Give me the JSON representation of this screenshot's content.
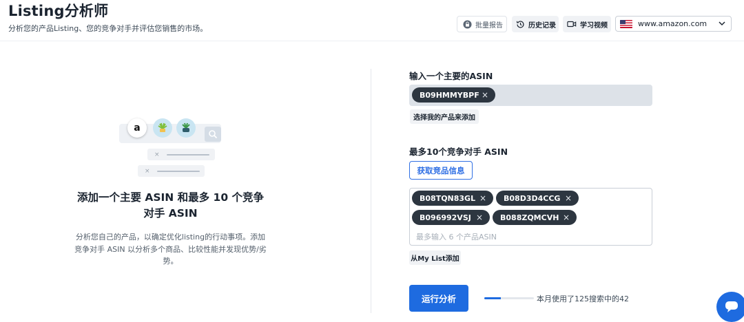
{
  "header": {
    "title": "Listing分析师",
    "subtitle": "分析您的产品Listing、您的竞争对手并评估您销售的市场。",
    "batch_report": "批量报告",
    "history": "历史记录",
    "video": "学习视频",
    "marketplace": "www.amazon.com"
  },
  "illustration": {
    "amazon_glyph": "a",
    "row_x": "×"
  },
  "left_panel": {
    "title": "添加一个主要 ASIN 和最多 10 个竞争对手 ASIN",
    "description": "分析您自己的产品，以确定优化listing的行动事项。添加竞争对手 ASIN 以分析多个商品、比较性能并发现优势/劣势。"
  },
  "main_asin": {
    "label": "输入一个主要的ASIN",
    "chips": [
      "B09HMMYBPF"
    ],
    "select_button": "选择我的产品来添加"
  },
  "competitors": {
    "label": "最多10个竞争对手 ASIN",
    "fetch_button": "获取竞品信息",
    "chips": [
      "B08TQN83GL",
      "B08D3D4CCG",
      "B096992VSJ",
      "B088ZQMCVH"
    ],
    "placeholder": "最多输入 6 个产品ASIN",
    "mylist_button": "从My List添加"
  },
  "chip_close": "×",
  "footer": {
    "run_button": "运行分析",
    "usage_text": "本月使用了125搜索中的42",
    "usage_fraction": 0.336
  },
  "colors": {
    "accent": "#1e6be0",
    "chip_bg": "#2d3640"
  },
  "icons": {
    "batch": "lock-icon",
    "history": "history-icon",
    "video": "video-icon",
    "marketplace": "us-flag-icon",
    "chat": "chat-icon"
  }
}
